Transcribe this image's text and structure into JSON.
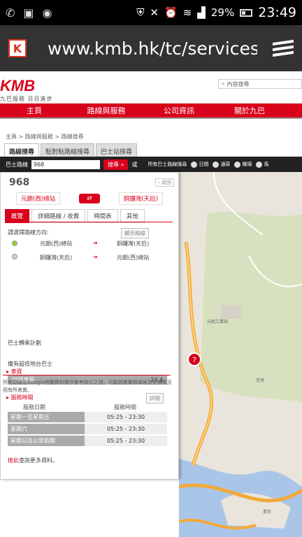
{
  "status": {
    "battery": "29%",
    "time": "23:49"
  },
  "browser": {
    "url": "www.kmb.hk/tc/services/."
  },
  "site": {
    "logo_text": "KMB",
    "logo_slogan": "九巴服務 日日進步",
    "search_placeholder": "內容搜尋",
    "nav": [
      "主頁",
      "路線與服務",
      "公司資訊",
      "關於九巴"
    ],
    "breadcrumb": "主頁 > 路線與服務 > 路線搜尋",
    "tabs": [
      "路線搜尋",
      "點對點路線搜尋",
      "巴士站搜尋"
    ],
    "route_label": "巴士路線",
    "route_value": "968",
    "search_btn": "搜尋 »",
    "or": "或",
    "all_routes": "所有巴士路線搜尋",
    "options": [
      "日間",
      "通宵",
      "機場",
      "馬"
    ]
  },
  "panel": {
    "route": "968",
    "back": "‹ 返回",
    "from": "元朗(西)總站",
    "to": "銅鑼灣(天后)",
    "tabs": [
      "概覽",
      "詳細路線 / 收費",
      "時間表",
      "其他"
    ],
    "select_dir": "請選擇路線方向:",
    "show_route": "顯示路線",
    "dir1_from": "元朗(西)總站",
    "dir1_to": "銅鑼灣(天后)",
    "dir2_from": "銅鑼灣(天后)",
    "dir2_to": "元朗(西)總站",
    "interchange": "巴士轉乘計劃",
    "low_floor": "備有超低地台巴士",
    "fare_title": "車資",
    "fare_type": "空調車資",
    "fare_value": "23.4",
    "hours_title": "服務時間",
    "detail_btn": "詳細",
    "col_day": "服務日期",
    "col_time": "服務時間",
    "rows": [
      {
        "day": "星期一至星期五",
        "time": "05:25 - 23:30"
      },
      {
        "day": "星期六",
        "time": "05:25 - 23:30"
      },
      {
        "day": "星期日及公眾假期",
        "time": "05:25 - 23:30"
      }
    ],
    "more_link": "按此",
    "more_text": "查詢更多資料。",
    "disclaimer": "所有路線及Google地圖資料僅作參考指引之用，可能因應實際環境及交通情況而有所差異。"
  },
  "map": {
    "marker": "7",
    "label1": "元朗工業邨",
    "label2": "青衣",
    "label3": "荃灣"
  }
}
